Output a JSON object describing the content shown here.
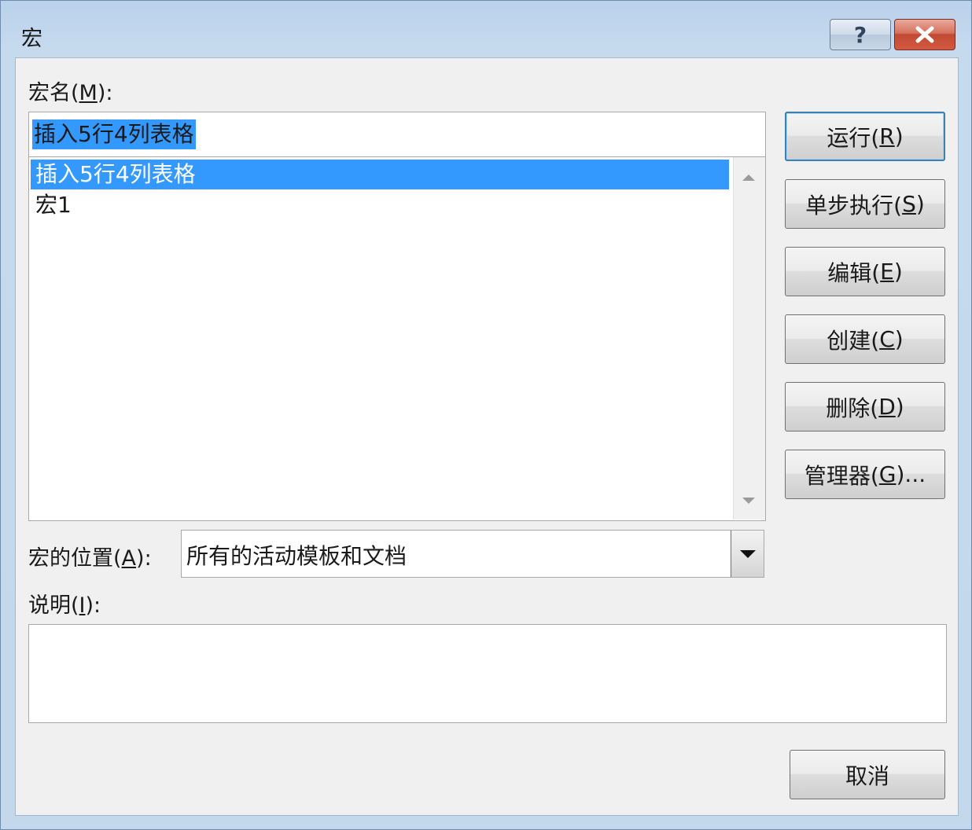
{
  "window": {
    "title": "宏",
    "help_label": "?"
  },
  "macro_name": {
    "label_prefix": "宏名(",
    "label_accel": "M",
    "label_suffix": "):",
    "value": "插入5行4列表格"
  },
  "macro_list": {
    "items": [
      {
        "label": "插入5行4列表格",
        "selected": true
      },
      {
        "label": "宏1",
        "selected": false
      }
    ]
  },
  "buttons": {
    "run": {
      "prefix": "运行(",
      "accel": "R",
      "suffix": ")"
    },
    "step": {
      "prefix": "单步执行(",
      "accel": "S",
      "suffix": ")"
    },
    "edit": {
      "prefix": "编辑(",
      "accel": "E",
      "suffix": ")"
    },
    "create": {
      "prefix": "创建(",
      "accel": "C",
      "suffix": ")"
    },
    "delete": {
      "prefix": "删除(",
      "accel": "D",
      "suffix": ")"
    },
    "organizer": {
      "prefix": "管理器(",
      "accel": "G",
      "suffix": ")..."
    },
    "cancel": {
      "label": "取消"
    }
  },
  "location": {
    "label_prefix": "宏的位置(",
    "label_accel": "A",
    "label_suffix": "):",
    "value": "所有的活动模板和文档"
  },
  "description": {
    "label_prefix": "说明(",
    "label_accel": "I",
    "label_suffix": "):",
    "value": ""
  },
  "colors": {
    "selection": "#3399ff",
    "client_bg": "#f0f0f0",
    "title_bg": "#c4d8ec",
    "close_red": "#c24a34"
  }
}
